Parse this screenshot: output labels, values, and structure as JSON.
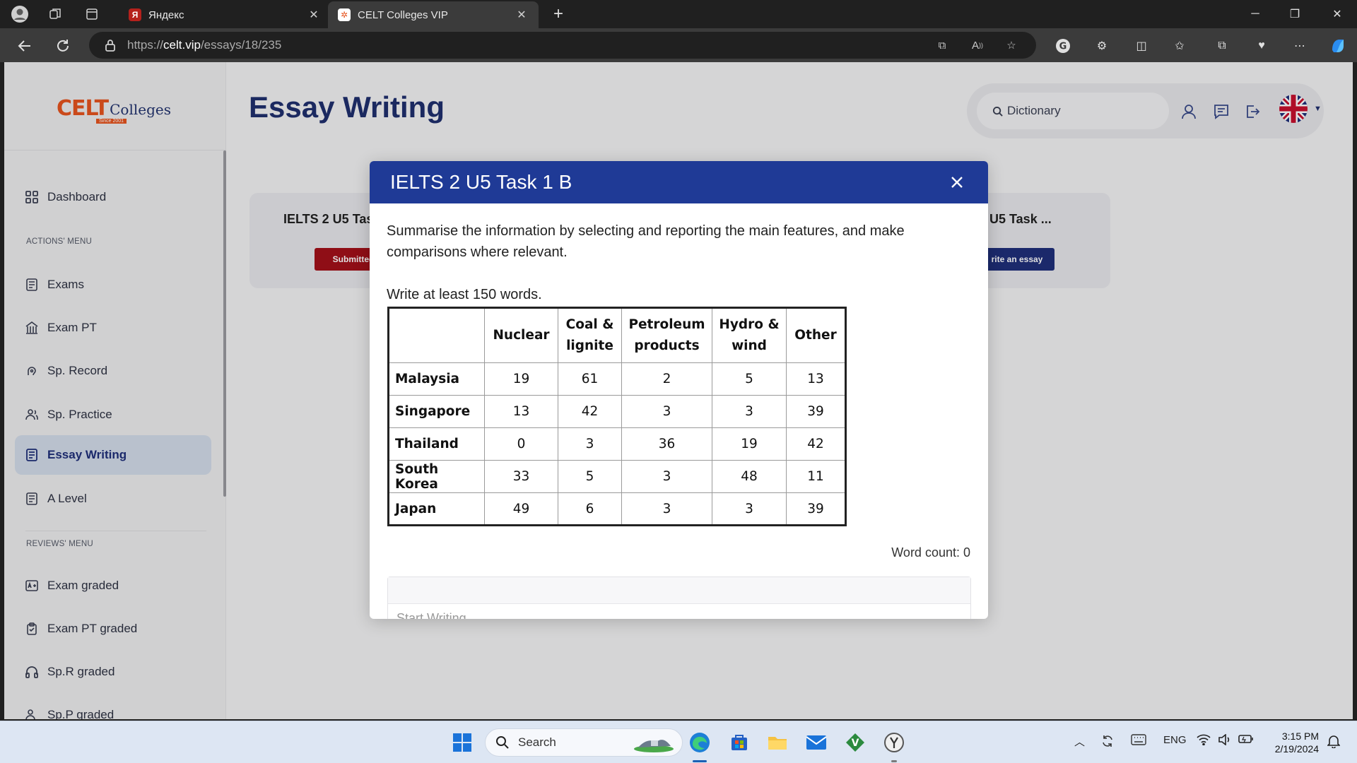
{
  "browser": {
    "tabs": [
      {
        "title": "Яндекс",
        "favicon": "yandex-icon",
        "active": false
      },
      {
        "title": "CELT Colleges VIP",
        "favicon": "celt-icon",
        "active": true
      }
    ],
    "url_prefix": "https://",
    "url_host": "celt.vip",
    "url_path": "/essays/18/235"
  },
  "logo": {
    "brand": "CELT",
    "name": "Colleges",
    "since": "Since 2001"
  },
  "sidebar": {
    "items": [
      {
        "label": "Dashboard",
        "icon": "grid-icon"
      },
      {
        "label": "Exams",
        "icon": "exam-icon"
      },
      {
        "label": "Exam PT",
        "icon": "building-icon"
      },
      {
        "label": "Sp. Record",
        "icon": "speech-icon"
      },
      {
        "label": "Sp. Practice",
        "icon": "people-icon"
      },
      {
        "label": "Essay Writing",
        "icon": "essay-icon",
        "active": true
      },
      {
        "label": "A Level",
        "icon": "document-icon"
      },
      {
        "label": "Exam graded",
        "icon": "grade-icon"
      },
      {
        "label": "Exam PT graded",
        "icon": "clipboard-icon"
      },
      {
        "label": "Sp.R graded",
        "icon": "headphones-icon"
      },
      {
        "label": "Sp.P graded",
        "icon": "people-icon"
      }
    ],
    "actions_header": "ACTIONS' MENU",
    "reviews_header": "REVIEWS' MENU"
  },
  "header": {
    "page_title": "Essay Writing",
    "search_placeholder": "Dictionary"
  },
  "cards": {
    "left_title": "IELTS 2 U5 Tas",
    "left_button": "Submitted",
    "right_title": "U5 Task ...",
    "right_button": "rite an essay"
  },
  "modal": {
    "title": "IELTS 2 U5 Task 1 B",
    "description": "Summarise the information by selecting and reporting the main features, and make comparisons where relevant.",
    "min_words": "Write at least 150 words.",
    "table": {
      "headers": [
        "",
        "Nuclear",
        "Coal & lignite",
        "Petroleum products",
        "Hydro & wind",
        "Other"
      ],
      "rows": [
        [
          "Malaysia",
          "19",
          "61",
          "2",
          "5",
          "13"
        ],
        [
          "Singapore",
          "13",
          "42",
          "3",
          "3",
          "39"
        ],
        [
          "Thailand",
          "0",
          "3",
          "36",
          "19",
          "42"
        ],
        [
          "South Korea",
          "33",
          "5",
          "3",
          "48",
          "11"
        ],
        [
          "Japan",
          "49",
          "6",
          "3",
          "3",
          "39"
        ]
      ]
    },
    "word_count": "Word count: 0",
    "editor_placeholder": "Start Writing"
  },
  "taskbar": {
    "search_label": "Search",
    "language": "ENG",
    "time": "3:15 PM",
    "date": "2/19/2024"
  },
  "colors": {
    "brand_blue": "#1f3a96",
    "brand_orange": "#e6541e",
    "submitted_red": "#a3111a",
    "nav_active_bg": "#d3dcea"
  }
}
